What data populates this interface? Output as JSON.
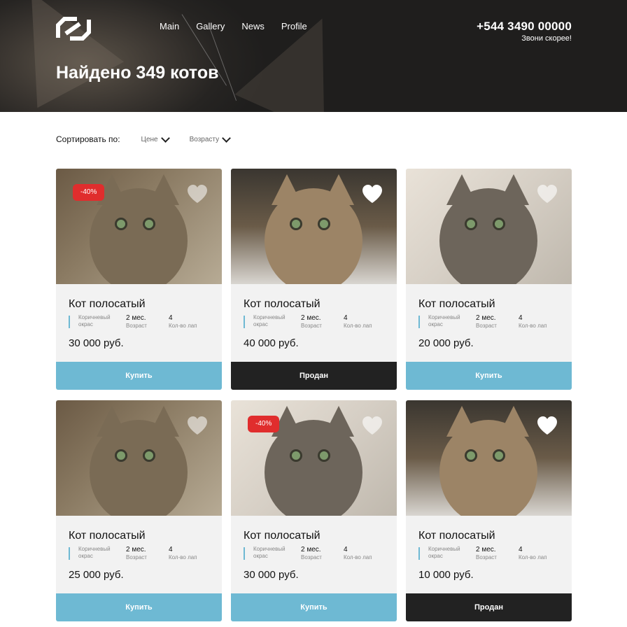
{
  "header": {
    "nav": [
      "Main",
      "Gallery",
      "News",
      "Profile"
    ],
    "phone": "+544 3490 00000",
    "phone_cta": "Звони скорее!",
    "title": "Найдено 349 котов"
  },
  "sort": {
    "label": "Сортировать по:",
    "options": [
      "Цене",
      "Возрасту"
    ]
  },
  "colors": {
    "buy_button": "#6eb9d3",
    "sold_button": "#222222",
    "badge": "#e02d2d",
    "card_bg": "#f2f2f2"
  },
  "cards": [
    {
      "name": "Кот полосатый",
      "color_label": "Коричневый окрас",
      "age": "2 мес.",
      "age_label": "Возраст",
      "paws": "4",
      "paws_label": "Кол-во лап",
      "price": "30 000 руб.",
      "button": "Купить",
      "status": "buy",
      "badge": "-40%",
      "favorite": false
    },
    {
      "name": "Кот полосатый",
      "color_label": "Коричневый окрас",
      "age": "2 мес.",
      "age_label": "Возраст",
      "paws": "4",
      "paws_label": "Кол-во лап",
      "price": "40 000 руб.",
      "button": "Продан",
      "status": "sold",
      "badge": "",
      "favorite": true
    },
    {
      "name": "Кот полосатый",
      "color_label": "Коричневый окрас",
      "age": "2 мес.",
      "age_label": "Возраст",
      "paws": "4",
      "paws_label": "Кол-во лап",
      "price": "20 000 руб.",
      "button": "Купить",
      "status": "buy",
      "badge": "",
      "favorite": false
    },
    {
      "name": "Кот полосатый",
      "color_label": "Коричневый окрас",
      "age": "2 мес.",
      "age_label": "Возраст",
      "paws": "4",
      "paws_label": "Кол-во лап",
      "price": "25 000 руб.",
      "button": "Купить",
      "status": "buy",
      "badge": "",
      "favorite": false
    },
    {
      "name": "Кот полосатый",
      "color_label": "Коричневый окрас",
      "age": "2 мес.",
      "age_label": "Возраст",
      "paws": "4",
      "paws_label": "Кол-во лап",
      "price": "30 000 руб.",
      "button": "Купить",
      "status": "buy",
      "badge": "-40%",
      "favorite": false
    },
    {
      "name": "Кот полосатый",
      "color_label": "Коричневый окрас",
      "age": "2 мес.",
      "age_label": "Возраст",
      "paws": "4",
      "paws_label": "Кол-во лап",
      "price": "10 000 руб.",
      "button": "Продан",
      "status": "sold",
      "badge": "",
      "favorite": true
    }
  ]
}
